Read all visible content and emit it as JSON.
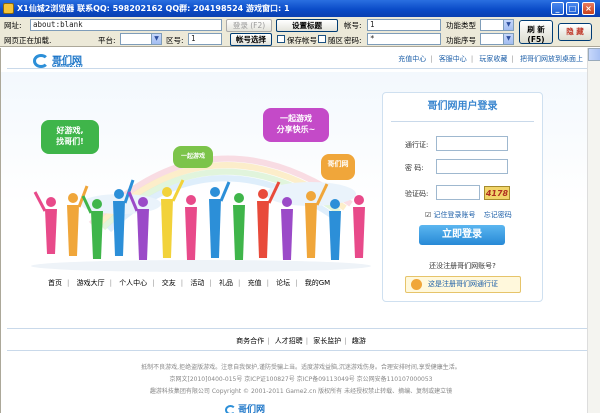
{
  "titlebar": {
    "title": "X1仙城2浏览器   联系QQ: 598202162   QQ群: 204198524   游戏窗口:  1",
    "minimize": "_",
    "maximize": "□",
    "close": "×"
  },
  "toolbar": {
    "url_label": "网址:",
    "url_value": "about:blank",
    "login_btn": "登录 (F2)",
    "set_title_btn": "设置标题",
    "account_label": "帐号:",
    "account_value": "1",
    "func_type_label": "功能类型",
    "refresh_btn": "刷 新",
    "refresh_sub": "(F5)",
    "hide_btn": "隐 藏",
    "status_label": "网页正在加载.",
    "platform_label": "平台:",
    "zone_label": "区号:",
    "zone_value": "1",
    "select_account_btn": "帐号选择",
    "save_account_label": "保存帐号",
    "random_zone_label": "随区",
    "password_label": "密码:",
    "password_value": "*",
    "func_seq_label": "功能序号"
  },
  "site": {
    "logo_name": "哥们网",
    "logo_domain": "Game2.cn",
    "top_links": [
      "充值中心",
      "客服中心",
      "玩家收藏",
      "把哥们网放到桌面上"
    ],
    "bubbles": [
      "好游戏,\n找哥们!",
      "一起游戏\n分享快乐~",
      "一起游戏",
      "哥们网"
    ],
    "nav": [
      "首页",
      "游戏大厅",
      "个人中心",
      "交友",
      "活动",
      "礼品",
      "充值",
      "论坛",
      "我的GM"
    ]
  },
  "login": {
    "title": "哥们网用户登录",
    "pass_label": "通行证:",
    "pwd_label": "密  码:",
    "captcha_label": "验证码:",
    "captcha_code": "4178",
    "remember": "记住登录账号",
    "forgot": "忘记密码",
    "submit": "立即登录",
    "no_account": "还没注册哥们网账号?",
    "register": "这是注册哥们网通行证"
  },
  "footer": {
    "links": [
      "商务合作",
      "人才招聘",
      "家长监护",
      "趣游"
    ],
    "line1": "抵制不良游戏,拒绝盗版游戏。注意自我保护,谨防受骗上当。适度游戏益脑,沉迷游戏伤身。合理安排时间,享受健康生活。",
    "line2": "京网文[2010]0400-015号  京ICP证100827号  京ICP备09113049号  京公网安备110107000053",
    "line3": "趣游科技集团有限公司 Copyright © 2001-2011 Game2.cn 版权所有 未经授权禁止转载、摘编、复制或建立镜",
    "logo": "哥们网"
  }
}
